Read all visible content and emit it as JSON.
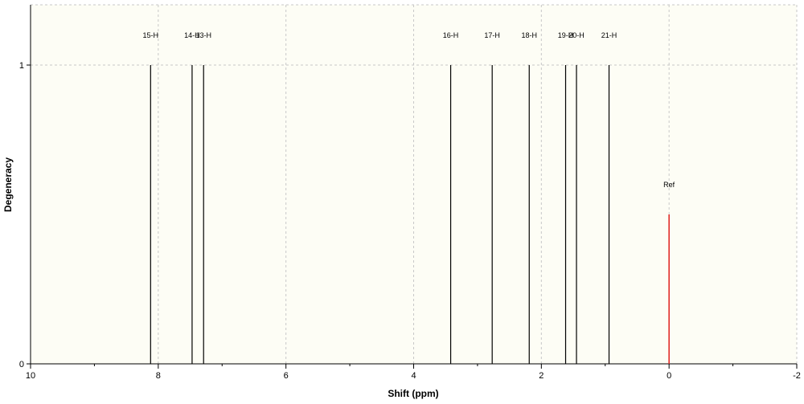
{
  "chart_data": {
    "type": "bar",
    "xlabel": "Shift (ppm)",
    "ylabel": "Degeneracy",
    "xlim": [
      10,
      -2
    ],
    "ylim": [
      0,
      1.2
    ],
    "x_ticks": [
      10,
      8,
      6,
      4,
      2,
      0,
      -2
    ],
    "x_tick_labels": [
      "10",
      "8",
      "6",
      "4",
      "2",
      "0",
      "-2"
    ],
    "y_ticks": [
      0,
      1
    ],
    "y_tick_labels": [
      "0",
      "1"
    ],
    "grid": true,
    "peaks": [
      {
        "label": "15-H",
        "x": 8.12,
        "y": 1
      },
      {
        "label": "14-H",
        "x": 7.47,
        "y": 1
      },
      {
        "label": "13-H",
        "x": 7.29,
        "y": 1
      },
      {
        "label": "16-H",
        "x": 3.42,
        "y": 1
      },
      {
        "label": "17-H",
        "x": 2.77,
        "y": 1
      },
      {
        "label": "18-H",
        "x": 2.19,
        "y": 1
      },
      {
        "label": "19-H",
        "x": 1.62,
        "y": 1
      },
      {
        "label": "20-H",
        "x": 1.45,
        "y": 1
      },
      {
        "label": "21-H",
        "x": 0.94,
        "y": 1
      }
    ],
    "reference": {
      "label": "Ref",
      "x": 0,
      "y": 0.5,
      "color": "#e0201c"
    },
    "colors": {
      "background": "#fdfdf5",
      "peak": "#000000",
      "grid": "#c8c8c8",
      "axis": "#000000"
    }
  }
}
